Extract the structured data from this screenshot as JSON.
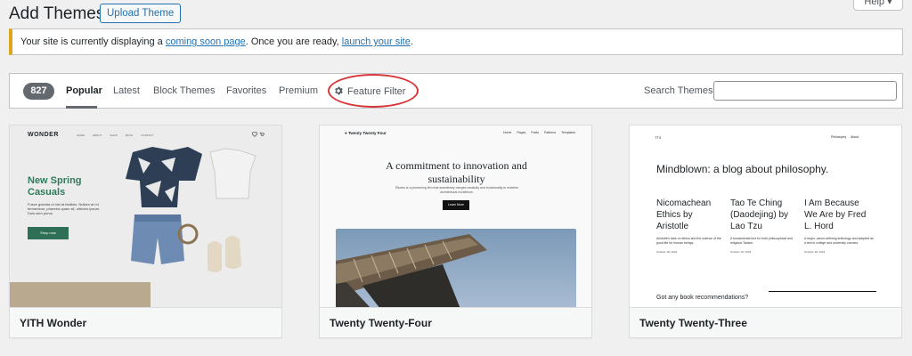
{
  "header": {
    "title": "Add Themes",
    "upload_label": "Upload Theme",
    "help_label": "Help ▾"
  },
  "notice": {
    "prefix": "Your site is currently displaying a ",
    "link1": "coming soon page",
    "middle": ". Once you are ready, ",
    "link2": "launch your site",
    "suffix": "."
  },
  "filters": {
    "count": "827",
    "tabs": [
      "Popular",
      "Latest",
      "Block Themes",
      "Favorites",
      "Premium"
    ],
    "feature_filter": "Feature Filter",
    "search_label": "Search Themes",
    "search_value": ""
  },
  "themes": [
    {
      "name": "YITH Wonder",
      "preview": {
        "logo": "WONDER",
        "links": [
          "HOME",
          "ABOUT",
          "SHOP",
          "BLOG",
          "CONTACT"
        ],
        "headline": "New Spring Casuals",
        "desc": "Fusce gravida ut nisi at facilisis. Nullam at mi fermentum, pharetra quam sit, ultricies ipsum. Duis sem purus.",
        "button": "Shop now"
      }
    },
    {
      "name": "Twenty Twenty-Four",
      "preview": {
        "brand": "Twenty Twenty Four",
        "menu": [
          "Home",
          "Pages",
          "Posts",
          "Patterns",
          "Templates"
        ],
        "headline": "A commitment to innovation and sustainability",
        "desc": "Études is a pioneering firm that seamlessly merges creativity and functionality to redefine architectural excellence.",
        "button": "Learn More"
      }
    },
    {
      "name": "Twenty Twenty-Three",
      "preview": {
        "brand": "TT3",
        "menu": [
          "Philosophy",
          "About"
        ],
        "headline": "Mindblown: a blog about philosophy.",
        "posts": [
          {
            "title": "Nicomachean Ethics by Aristotle",
            "desc": "Aristotle's take on ethics and the science of the good life for human beings.",
            "date": "October 18, 2023"
          },
          {
            "title": "Tao Te Ching (Daodejing) by Lao Tzu",
            "desc": "A fundamental text for both philosophical and religious Taoism.",
            "date": "October 18, 2023"
          },
          {
            "title": "I Am Because We Are by Fred L. Hord",
            "desc": "A major, canon-defining anthology and adopted as a text in college and university courses.",
            "date": "October 18, 2023"
          }
        ],
        "footer": "Got any book recommendations?"
      }
    }
  ],
  "colors": {
    "accent": "#2271b1",
    "notice_border": "#dba617",
    "highlight_ring": "#d63638",
    "wonder_green": "#2f7a5b"
  }
}
